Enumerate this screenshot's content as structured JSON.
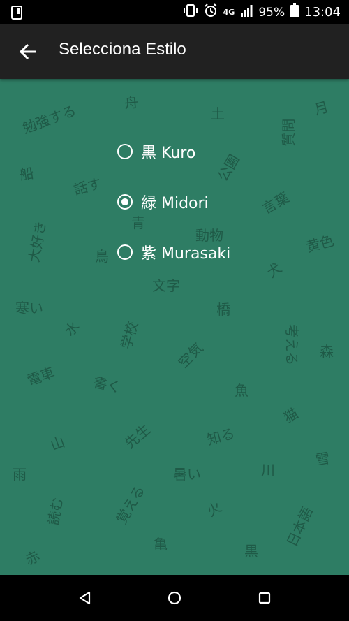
{
  "status": {
    "battery": "95%",
    "time": "13:04",
    "network": "4G"
  },
  "app_bar": {
    "title": "Selecciona Estilo"
  },
  "options": [
    {
      "label": "黒 Kuro",
      "selected": false
    },
    {
      "label": "緑 Midori",
      "selected": true
    },
    {
      "label": "紫 Murasaki",
      "selected": false
    }
  ],
  "background_words": {
    "w1": "勉強する",
    "w2": "舟",
    "w3": "土",
    "w4": "月",
    "w5": "質問",
    "w6": "船",
    "w7": "話す",
    "w8": "公園",
    "w9": "言葉",
    "w10": "大好き",
    "w11": "青",
    "w12": "動物",
    "w13": "鳥",
    "w14": "黄色",
    "w15": "犬",
    "w16": "文字",
    "w17": "寒い",
    "w18": "橋",
    "w19": "水",
    "w20": "学校",
    "w21": "考える",
    "w22": "森",
    "w23": "空気",
    "w24": "電車",
    "w25": "書く",
    "w26": "魚",
    "w27": "猫",
    "w28": "山",
    "w29": "先生",
    "w30": "知る",
    "w31": "雪",
    "w32": "雨",
    "w33": "暑い",
    "w34": "川",
    "w35": "読む",
    "w36": "覚える",
    "w37": "火",
    "w38": "日本語",
    "w39": "亀",
    "w40": "赤",
    "w41": "黒"
  },
  "colors": {
    "status_bar": "#000000",
    "app_bar": "#212121",
    "content_bg": "#2e7d64",
    "bg_text": "#1f5a47"
  }
}
